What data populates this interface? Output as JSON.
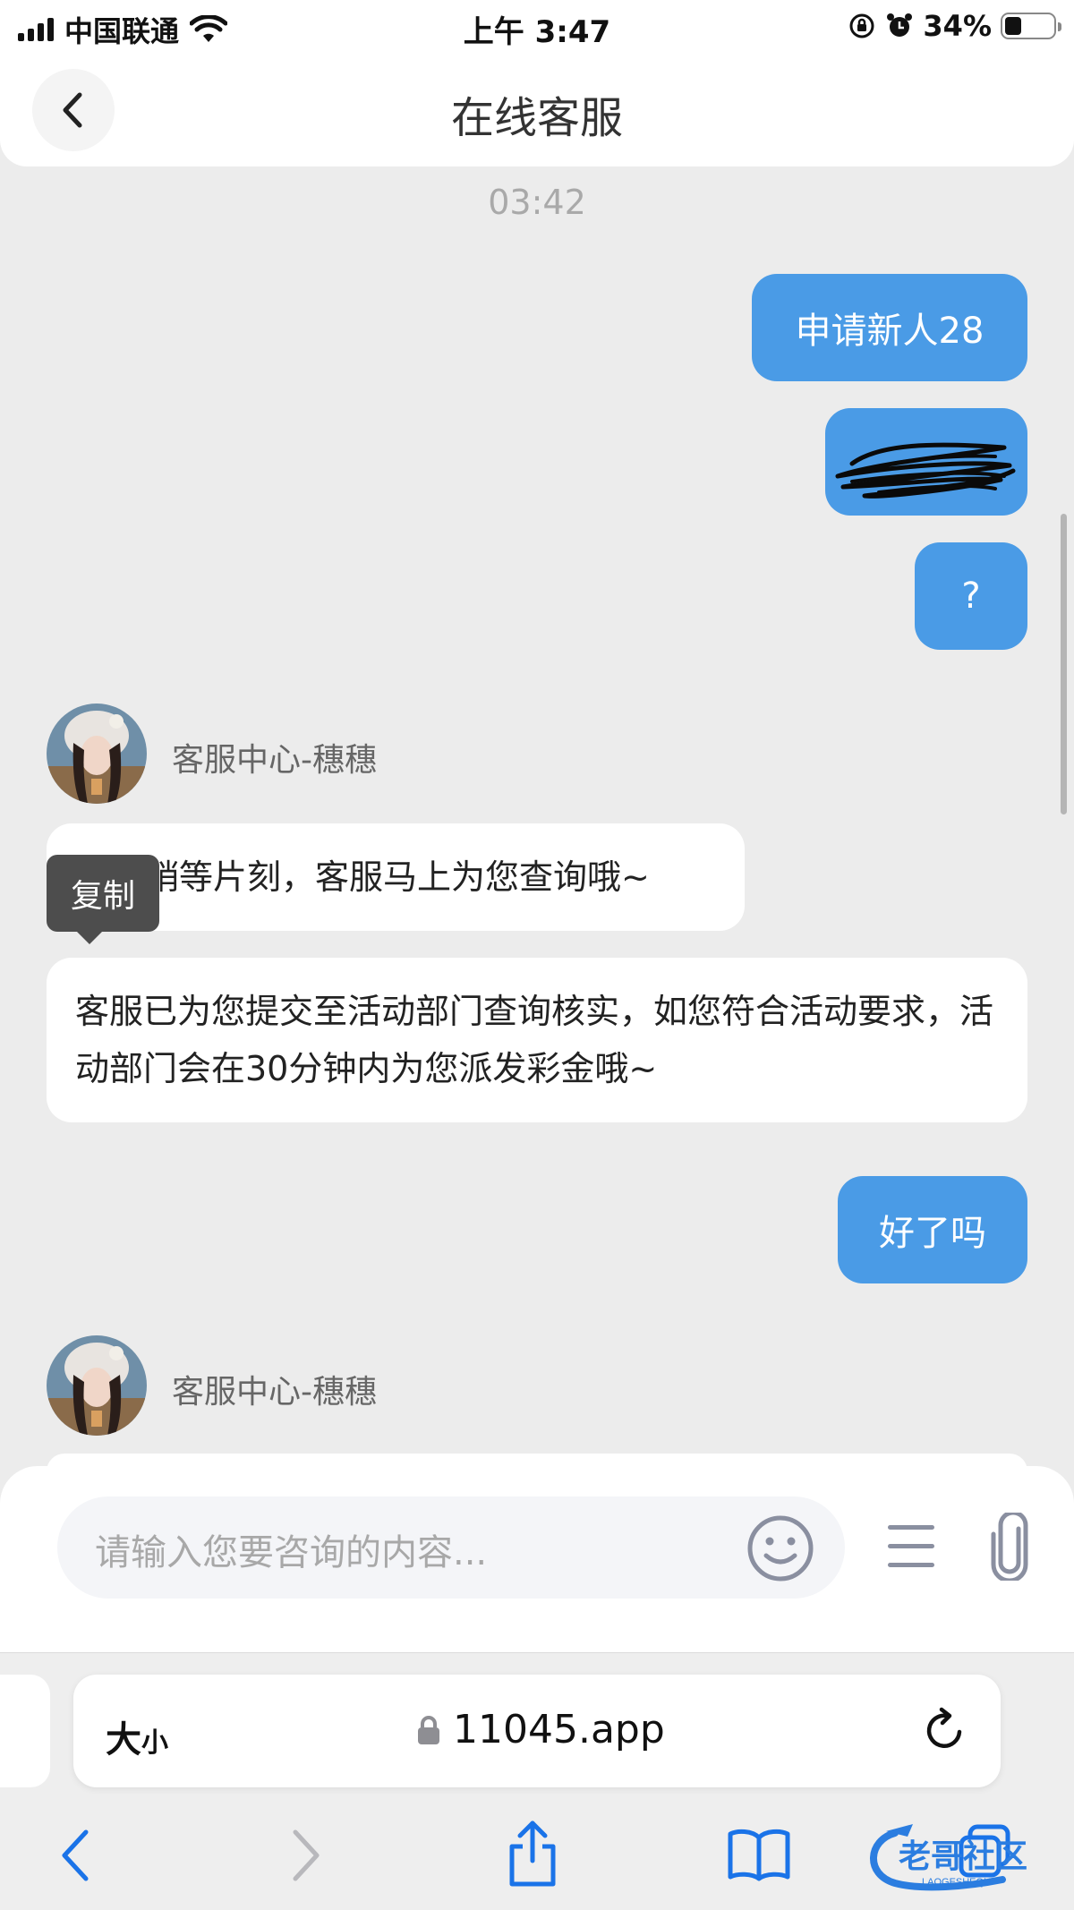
{
  "status_bar": {
    "carrier": "中国联通",
    "time": "上午 3:47",
    "battery_percent": "34%",
    "battery_level": 0.34
  },
  "header": {
    "title": "在线客服"
  },
  "chat": {
    "timestamp": "03:42",
    "outgoing": [
      {
        "text": "申请新人28"
      },
      {
        "text": ""
      },
      {
        "text": "?"
      },
      {
        "text": "好了吗"
      }
    ],
    "agent_name": "客服中心-穗穗",
    "incoming": [
      {
        "text": "请您稍等片刻，客服马上为您查询哦~"
      },
      {
        "text": "客服已为您提交至活动部门查询核实，如您符合活动要求，活动部门会在30分钟内为您派发彩金哦~"
      }
    ],
    "tooltip": "复制"
  },
  "input": {
    "placeholder": "请输入您要咨询的内容..."
  },
  "browser": {
    "text_size_label": "大",
    "text_size_small": "小",
    "url": "11045.app",
    "watermark": "老哥社区",
    "watermark_sub": "LAOGESHEQU"
  },
  "colors": {
    "accent": "#4a9be6",
    "background": "#ececec",
    "bubble_in": "#ffffff",
    "tooltip": "#4d4d4d",
    "safari_blue": "#1a73e8"
  },
  "icons": {
    "back": "chevron-left-icon",
    "emoji": "smiley-icon",
    "menu": "hamburger-icon",
    "attach": "paperclip-icon",
    "lock": "lock-icon",
    "reload": "reload-icon",
    "share": "share-icon",
    "bookmarks": "book-icon",
    "tabs": "tabs-icon"
  }
}
